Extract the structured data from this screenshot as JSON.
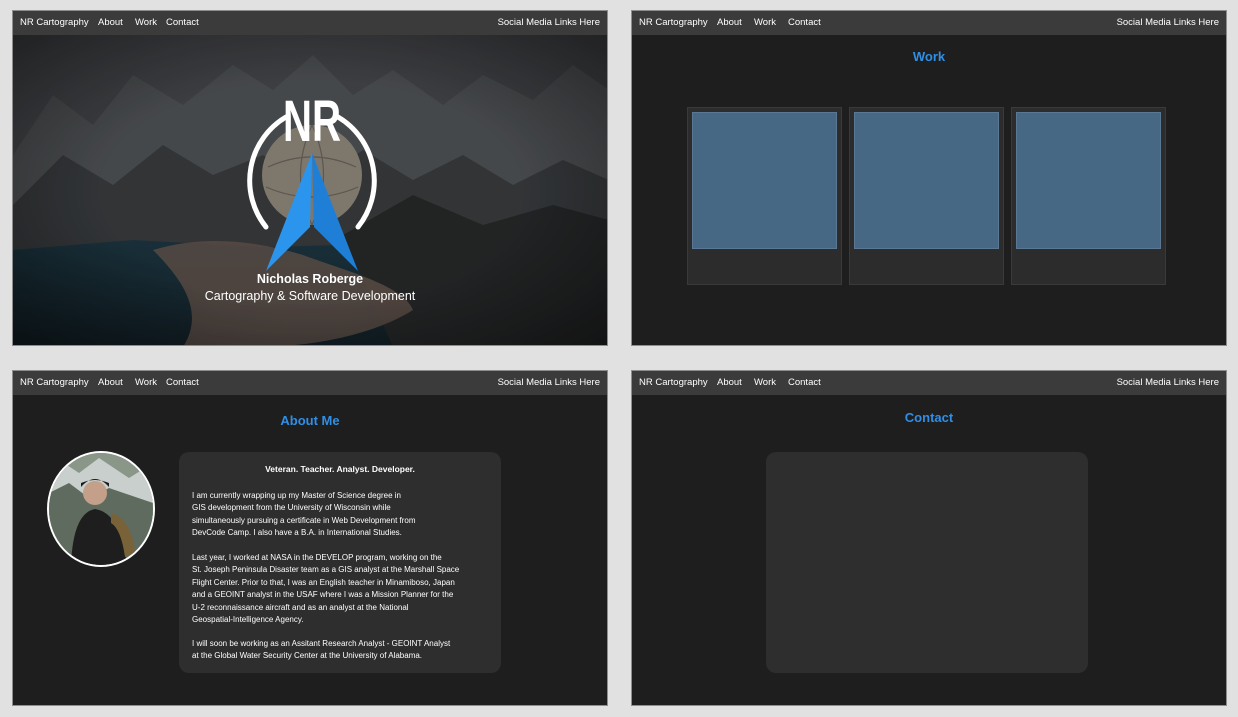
{
  "nav": {
    "brand": "NR Cartography",
    "links": [
      "About",
      "Work",
      "Contact"
    ],
    "social": "Social Media Links Here"
  },
  "hero": {
    "logo_text": "NR",
    "name": "Nicholas Roberge",
    "subtitle": "Cartography & Software Development"
  },
  "work": {
    "title": "Work"
  },
  "about": {
    "title": "About Me",
    "tagline": "Veteran. Teacher. Analyst. Developer.",
    "paragraphs": [
      "I am currently wrapping up my Master of Science degree in\nGIS development from the University of Wisconsin while\nsimultaneously pursuing a certificate in Web Development from\nDevCode Camp. I also have a B.A. in International Studies.",
      "Last year, I worked at NASA in the DEVELOP program, working on the\nSt. Joseph Peninsula Disaster team as a GIS analyst at the Marshall Space\nFlight Center. Prior to that, I was an English teacher in Minamiboso, Japan\nand a GEOINT analyst in the USAF where I was a Mission Planner for the\nU-2 reconnaissance aircraft and as an analyst at the National\nGeospatial-Intelligence Agency.",
      "I will soon be working as an Assitant Research Analyst - GEOINT Analyst\n at the Global Water Security Center at the University of Alabama."
    ]
  },
  "contact": {
    "title": "Contact"
  },
  "colors": {
    "accent": "#2f8fe6",
    "nav_bg": "#3b3b3b",
    "panel_bg": "#1e1e1e",
    "card_bg": "#2e2e2e",
    "thumb": "#476885"
  }
}
